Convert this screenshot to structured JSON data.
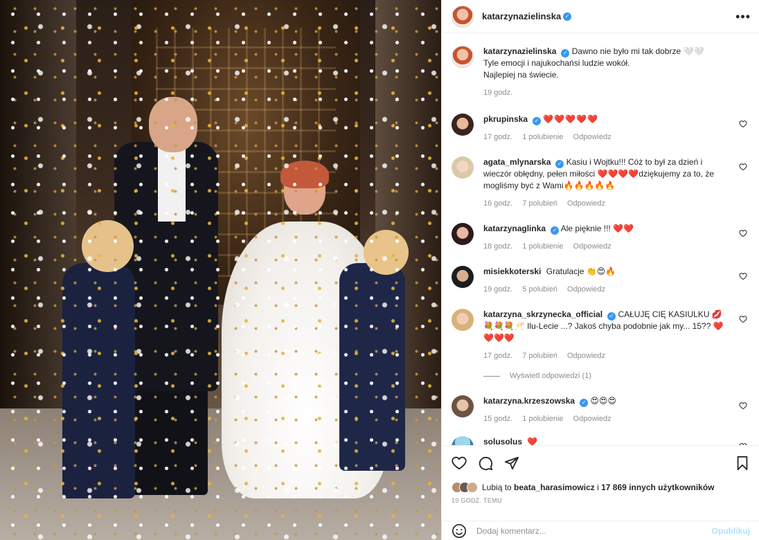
{
  "post": {
    "username": "katarzynazielinska",
    "more_icon": "more-horizontal-icon"
  },
  "caption": {
    "username": "katarzynazielinska",
    "line1": "Dawno nie było mi tak dobrze 🤍🤍",
    "line2": "Tyle emocji i najukochańsi ludzie wokół.",
    "line3": "Najlepiej na świecie.",
    "time": "19 godz."
  },
  "comments": [
    {
      "username": "pkrupinska",
      "verified": true,
      "text": "❤️❤️❤️❤️❤️",
      "time": "17 godz.",
      "likes": "1 polubienie",
      "reply": "Odpowiedz"
    },
    {
      "username": "agata_mlynarska",
      "verified": true,
      "text": "Kasiu i Wojtku!!! Cóż to był za dzień i wieczór obłędny, pełen miłości ❤️❤️❤️❤️dziękujemy za to, że mogliśmy być z Wami🔥🔥🔥🔥🔥",
      "time": "16 godz.",
      "likes": "7 polubień",
      "reply": "Odpowiedz"
    },
    {
      "username": "katarzynaglinka",
      "verified": true,
      "text": "Ale pięknie !!! ❤️❤️",
      "time": "18 godz.",
      "likes": "1 polubienie",
      "reply": "Odpowiedz"
    },
    {
      "username": "misiekkoterski",
      "verified": false,
      "text": "Gratulacje 👏😍🔥",
      "time": "19 godz.",
      "likes": "5 polubień",
      "reply": "Odpowiedz"
    },
    {
      "username": "katarzyna_skrzynecka_official",
      "verified": true,
      "text": "CAŁUJĘ CIĘ KASIULKU 💋💐💐💐🥂 Ilu-Lecie ...? Jakoś chyba podobnie jak my... 15?? ❤️❤️❤️❤️",
      "time": "17 godz.",
      "likes": "7 polubień",
      "reply": "Odpowiedz",
      "view_replies": "Wyświetl odpowiedzi (1)"
    },
    {
      "username": "katarzyna.krzeszowska",
      "verified": true,
      "text": "😍😍😍",
      "time": "15 godz.",
      "likes": "1 polubienie",
      "reply": "Odpowiedz"
    },
    {
      "username": "solusolus",
      "verified": false,
      "text": "❤️",
      "time": "",
      "likes": "",
      "reply": ""
    }
  ],
  "likes": {
    "prefix": "Lubią to",
    "user": "beata_harasimowicz",
    "middle": "i",
    "rest": "17 869 innych użytkowników"
  },
  "posted": "19 GODZ. TEMU",
  "composer": {
    "placeholder": "Dodaj komentarz...",
    "post_label": "Opublikuj"
  },
  "colors": {
    "verified": "#3897f0",
    "heart": "#e0245e",
    "muted": "#8e8e8e",
    "post_disabled": "#b2dffc"
  }
}
